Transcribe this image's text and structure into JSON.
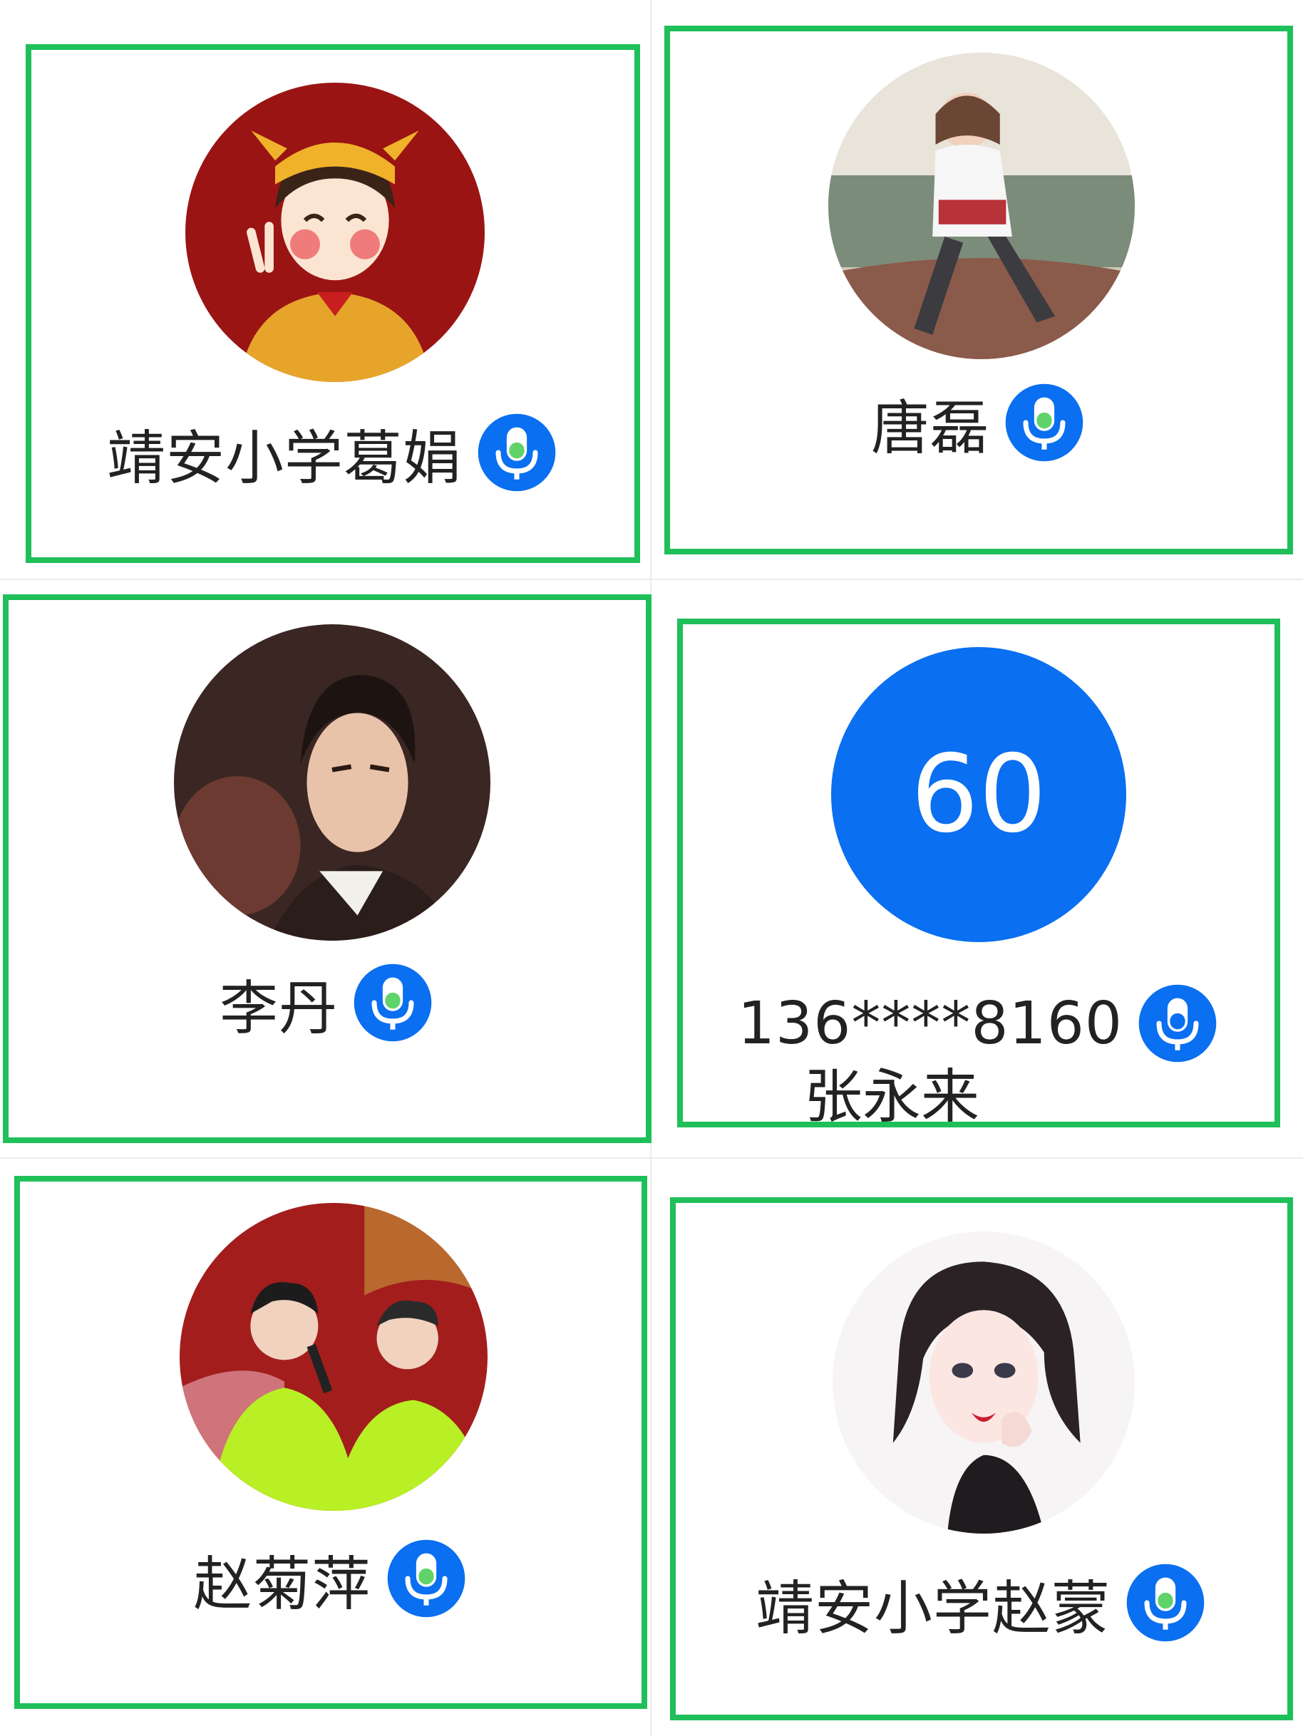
{
  "tiles": [
    {
      "name": "靖安小学葛娟",
      "avatar_icon": "cartoon-girl-ox-hat-avatar"
    },
    {
      "name": "唐磊",
      "avatar_icon": "photo-woman-sitting-avatar"
    },
    {
      "name": "李丹",
      "avatar_icon": "photo-man-portrait-avatar"
    },
    {
      "name": "136****8160",
      "sub_name": "张永来",
      "score": "60"
    },
    {
      "name": "赵菊萍",
      "avatar_icon": "photo-comedians-stage-avatar"
    },
    {
      "name": "靖安小学赵蒙",
      "avatar_icon": "illustrated-woman-avatar"
    }
  ],
  "mic_icon": "microphone-icon",
  "colors": {
    "tile_border": "#1fbf5a",
    "mic_blue": "#0a6ff0",
    "mic_green": "#5fd36a",
    "score_circle": "#0a6ff0"
  }
}
